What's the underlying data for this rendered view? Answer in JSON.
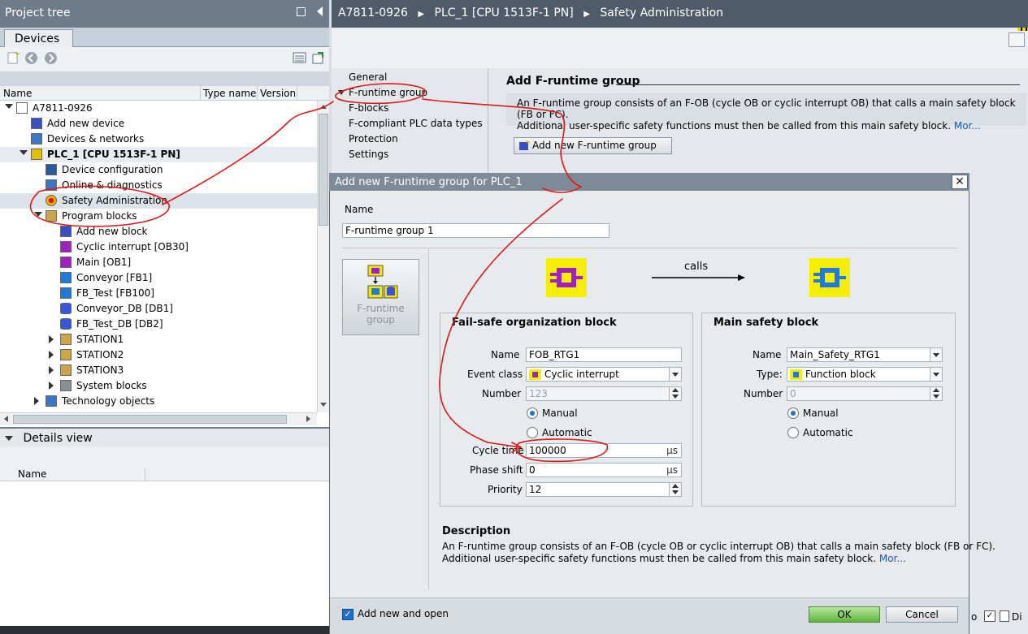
{
  "project_tree": {
    "title": "Project tree",
    "tab": "Devices",
    "columns": {
      "name": "Name",
      "type_name": "Type name",
      "version": "Version"
    },
    "items": [
      {
        "label": "A7811-0926",
        "indent": 0,
        "expander": "open",
        "icon": "document-icon",
        "color": "#ffffff"
      },
      {
        "label": "Add new device",
        "indent": 1,
        "expander": "none",
        "icon": "add-device-icon",
        "color": "#3a4fc4"
      },
      {
        "label": "Devices & networks",
        "indent": 1,
        "expander": "none",
        "icon": "network-icon",
        "color": "#3a77c4"
      },
      {
        "label": "PLC_1 [CPU 1513F-1 PN]",
        "indent": 1,
        "expander": "open",
        "icon": "plc-icon",
        "color": "#e0c000",
        "bold": true
      },
      {
        "label": "Device configuration",
        "indent": 2,
        "expander": "none",
        "icon": "device-config-icon",
        "color": "#2a5aa0"
      },
      {
        "label": "Online & diagnostics",
        "indent": 2,
        "expander": "none",
        "icon": "diagnostics-icon",
        "color": "#3a77c4"
      },
      {
        "label": "Safety Administration",
        "indent": 2,
        "expander": "none",
        "icon": "safety-icon",
        "color": "#e8b400",
        "selected": true
      },
      {
        "label": "Program blocks",
        "indent": 2,
        "expander": "open",
        "icon": "folder-icon",
        "color": "#c9a64a"
      },
      {
        "label": "Add new block",
        "indent": 3,
        "expander": "none",
        "icon": "add-block-icon",
        "color": "#3a4fc4"
      },
      {
        "label": "Cyclic interrupt [OB30]",
        "indent": 3,
        "expander": "none",
        "icon": "ob-icon",
        "color": "#a020c0"
      },
      {
        "label": "Main [OB1]",
        "indent": 3,
        "expander": "none",
        "icon": "ob-icon",
        "color": "#a020c0"
      },
      {
        "label": "Conveyor [FB1]",
        "indent": 3,
        "expander": "none",
        "icon": "fb-icon",
        "color": "#1f7ad8"
      },
      {
        "label": "FB_Test [FB100]",
        "indent": 3,
        "expander": "none",
        "icon": "fb-icon",
        "color": "#1f7ad8"
      },
      {
        "label": "Conveyor_DB [DB1]",
        "indent": 3,
        "expander": "none",
        "icon": "db-icon",
        "color": "#3a55d8"
      },
      {
        "label": "FB_Test_DB [DB2]",
        "indent": 3,
        "expander": "none",
        "icon": "db-icon",
        "color": "#3a55d8"
      },
      {
        "label": "STATION1",
        "indent": 3,
        "expander": "closed",
        "icon": "group-folder-icon",
        "color": "#c9a64a"
      },
      {
        "label": "STATION2",
        "indent": 3,
        "expander": "closed",
        "icon": "group-folder-icon",
        "color": "#c9a64a"
      },
      {
        "label": "STATION3",
        "indent": 3,
        "expander": "closed",
        "icon": "group-folder-icon",
        "color": "#c9a64a"
      },
      {
        "label": "System blocks",
        "indent": 3,
        "expander": "closed",
        "icon": "system-folder-icon",
        "color": "#8a8f96"
      },
      {
        "label": "Technology objects",
        "indent": 2,
        "expander": "closed",
        "icon": "technology-icon",
        "color": "#3a77c4"
      }
    ]
  },
  "details_view": {
    "title": "Details view",
    "column_name": "Name"
  },
  "editor": {
    "breadcrumb": [
      "A7811-0926",
      "PLC_1 [CPU 1513F-1 PN]",
      "Safety Administration"
    ],
    "nav": [
      "General",
      "F-runtime group",
      "F-blocks",
      "F-compliant PLC data types",
      "Protection",
      "Settings"
    ],
    "section_title": "Add F-runtime group",
    "info_line1": "An F-runtime group consists of an F-OB (cycle OB or cyclic interrupt OB) that calls a main safety block (FB or FC).",
    "info_line2": "Additional user-specific safety functions must then be called from this main safety block.",
    "more_link": "Mor...",
    "add_button": "Add new F-runtime group"
  },
  "dialog": {
    "title": "Add new F-runtime group for PLC_1",
    "name_label": "Name",
    "name_value": "F-runtime group 1",
    "fgroup_button": [
      "F-runtime",
      "group"
    ],
    "calls_label": "calls",
    "fob": {
      "title": "Fail-safe organization block",
      "name_label": "Name",
      "name_value": "FOB_RTG1",
      "event_class_label": "Event class",
      "event_class_value": "Cyclic interrupt",
      "number_label": "Number",
      "number_value": "123",
      "manual": "Manual",
      "automatic": "Automatic",
      "cycle_time_label": "Cycle time",
      "cycle_time_value": "100000",
      "cycle_time_unit": "µs",
      "phase_shift_label": "Phase shift",
      "phase_shift_value": "0",
      "phase_shift_unit": "µs",
      "priority_label": "Priority",
      "priority_value": "12"
    },
    "msb": {
      "title": "Main safety block",
      "name_label": "Name",
      "name_value": "Main_Safety_RTG1",
      "type_label": "Type:",
      "type_value": "Function block",
      "number_label": "Number",
      "number_value": "0",
      "manual": "Manual",
      "automatic": "Automatic"
    },
    "description_title": "Description",
    "description_line1": "An F-runtime group consists of an F-OB (cycle OB or cyclic interrupt OB) that calls a main safety block (FB or FC).",
    "description_line2": "Additional user-specific safety functions must then be called from this main safety block.",
    "more_link": "Mor...",
    "add_new_and_open": "Add new and open",
    "ok": "OK",
    "cancel": "Cancel"
  },
  "edge_labels": {
    "right1": "o",
    "right2": "Di"
  },
  "colors": {
    "accent": "#1e6fd1",
    "annotation": "#e01818",
    "ob_block": "#a020c0",
    "fb_block": "#1f7ad8"
  }
}
